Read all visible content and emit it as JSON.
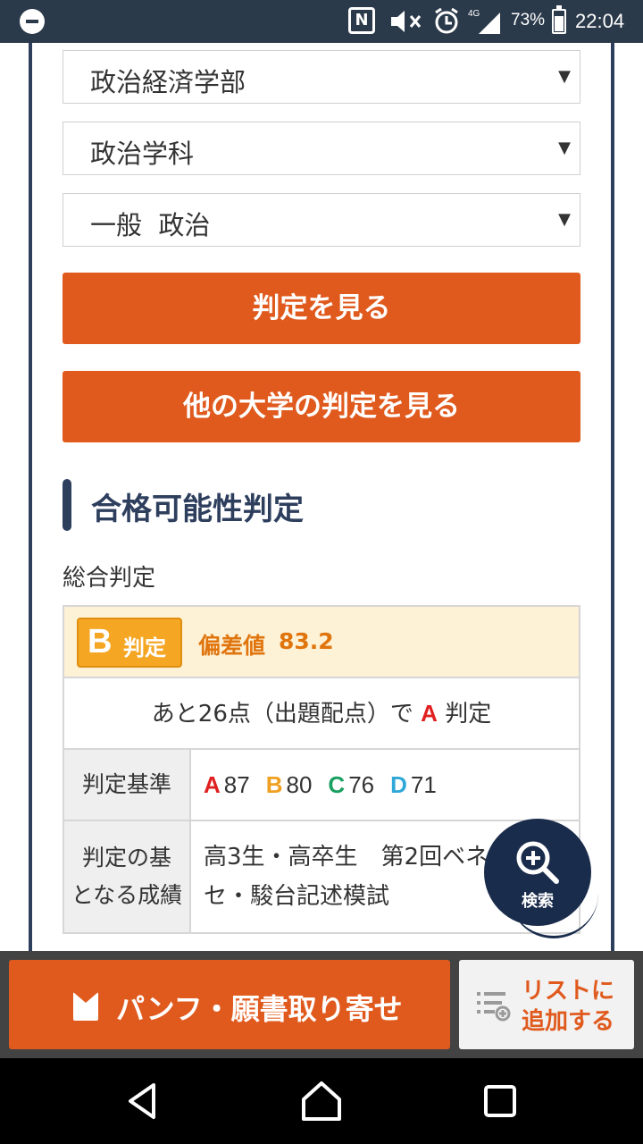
{
  "status_bar": {
    "battery": "73%",
    "time": "22:04",
    "network": "4G"
  },
  "selects": {
    "faculty": "政治経済学部",
    "department": "政治学科",
    "exam": "一般  政治"
  },
  "buttons": {
    "view_result": "判定を見る",
    "view_other": "他の大学の判定を見る"
  },
  "section": {
    "title": "合格可能性判定",
    "subtitle": "総合判定"
  },
  "result": {
    "grade_letter": "B",
    "grade_label": "判定",
    "deviation_label": "偏差値",
    "deviation_value": "83.2",
    "next_prefix": "あと26点（出題配点）で",
    "next_grade": "A",
    "next_suffix": "判定",
    "criteria_header": "判定基準",
    "criteria": [
      {
        "letter": "A",
        "value": "87",
        "color": "#e02020"
      },
      {
        "letter": "B",
        "value": "80",
        "color": "#f0a020"
      },
      {
        "letter": "C",
        "value": "76",
        "color": "#1aa060"
      },
      {
        "letter": "D",
        "value": "71",
        "color": "#30a8d8"
      }
    ],
    "basis_header_line1": "判定の基",
    "basis_header_line2": "となる成績",
    "basis_line1": "高3生・高卒生　第2回ベネ",
    "basis_line2": "セ・駿台記述模試"
  },
  "fab": {
    "label": "検索"
  },
  "bottom": {
    "pamphlet": "パンフ・願書取り寄せ",
    "add_list_line1": "リストに",
    "add_list_line2": "追加する"
  },
  "colors": {
    "accent": "#e05a1e",
    "navy": "#2e3f5e",
    "grade_b": "#f5a623"
  }
}
